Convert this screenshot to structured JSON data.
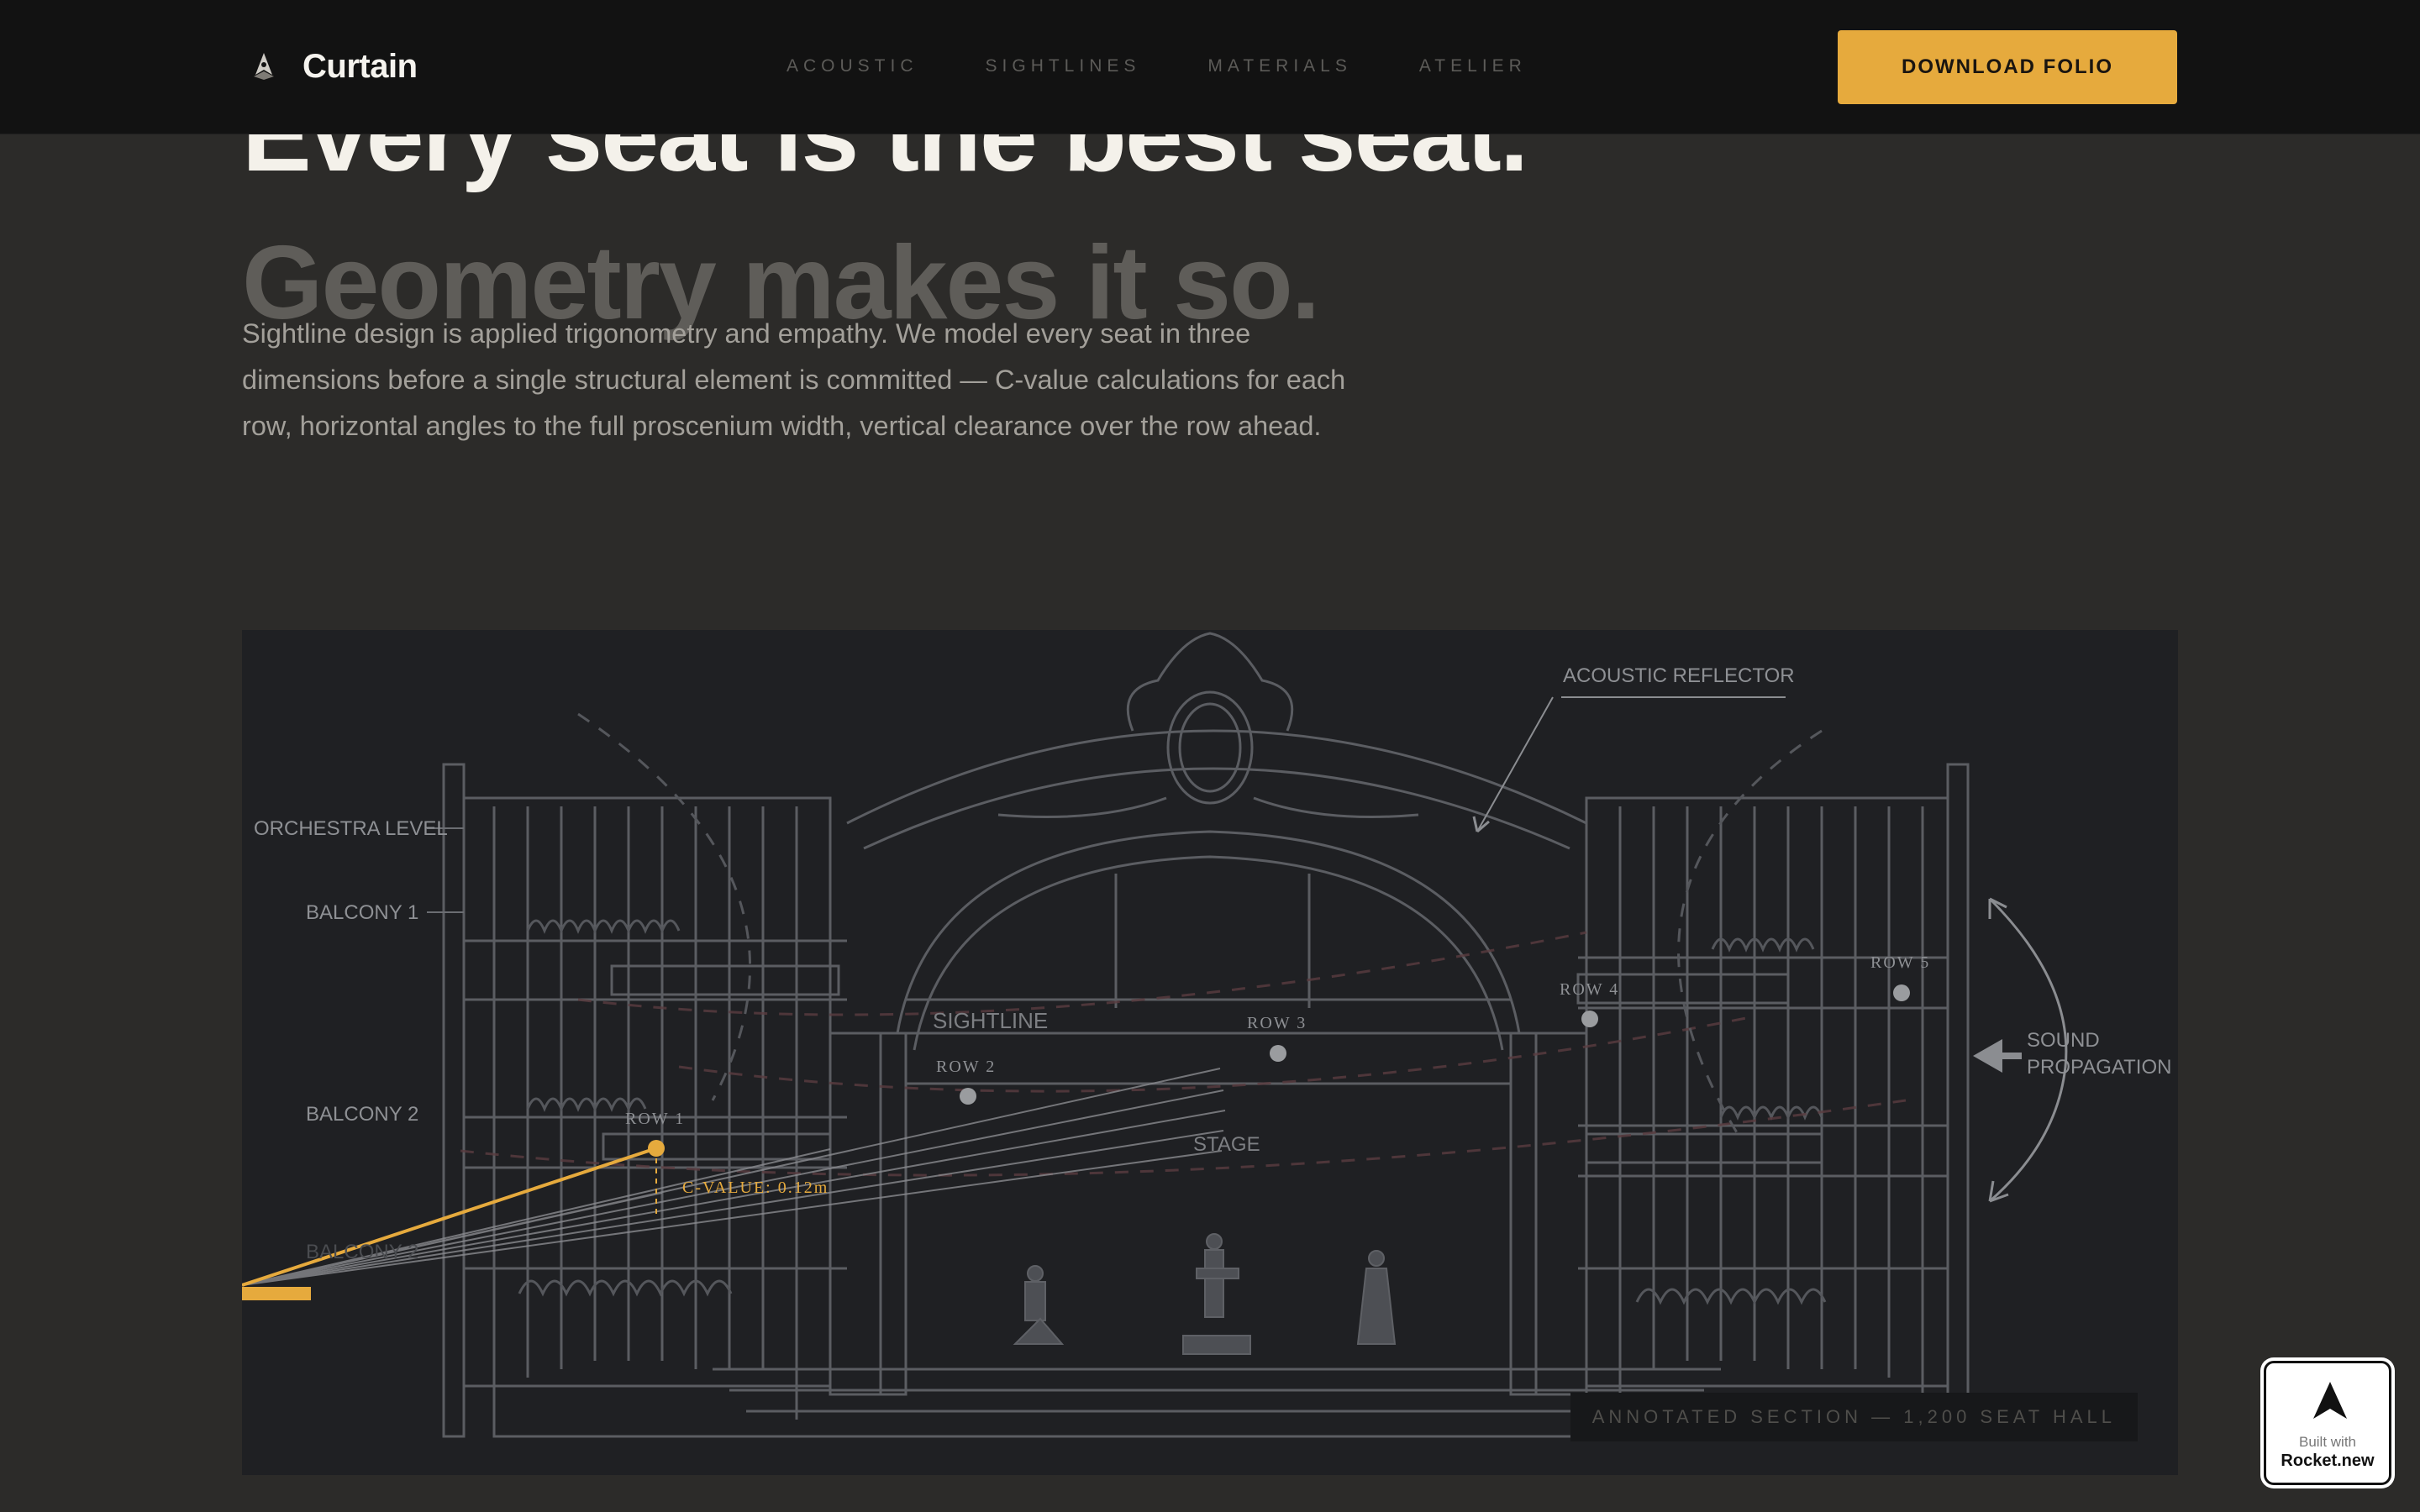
{
  "nav": {
    "brand": "Curtain",
    "links": [
      "ACOUSTIC",
      "SIGHTLINES",
      "MATERIALS",
      "ATELIER"
    ],
    "cta": "DOWNLOAD FOLIO"
  },
  "hero": {
    "title_line1": "Every seat is the best seat.",
    "title_line2": "Geometry makes it so.",
    "body": "Sightline design is applied trigonometry and empathy. We model every seat in three dimensions before a single structural element is committed — C-value calculations for each row, horizontal angles to the full proscenium width, vertical clearance over the row ahead."
  },
  "figure": {
    "labels": {
      "acoustic_reflector": "ACOUSTIC REFLECTOR",
      "orchestra_level": "ORCHESTRA LEVEL",
      "balcony1": "BALCONY 1",
      "balcony2": "BALCONY 2",
      "balcony2b": "BALCONY 2",
      "sightline": "SIGHTLINE",
      "stage": "STAGE",
      "sound1": "SOUND",
      "sound2": "PROPAGATION",
      "row1": "ROW 1",
      "row2": "ROW 2",
      "row3": "ROW 3",
      "row4": "ROW 4",
      "row5": "ROW 5",
      "cvalue": "C-VALUE: 0.12m"
    },
    "caption": "ANNOTATED SECTION — 1,200 SEAT HALL",
    "colors": {
      "accent": "#e6aa3d",
      "line": "#7a7c80"
    }
  },
  "badge": {
    "line1": "Built with",
    "line2": "Rocket.new"
  }
}
